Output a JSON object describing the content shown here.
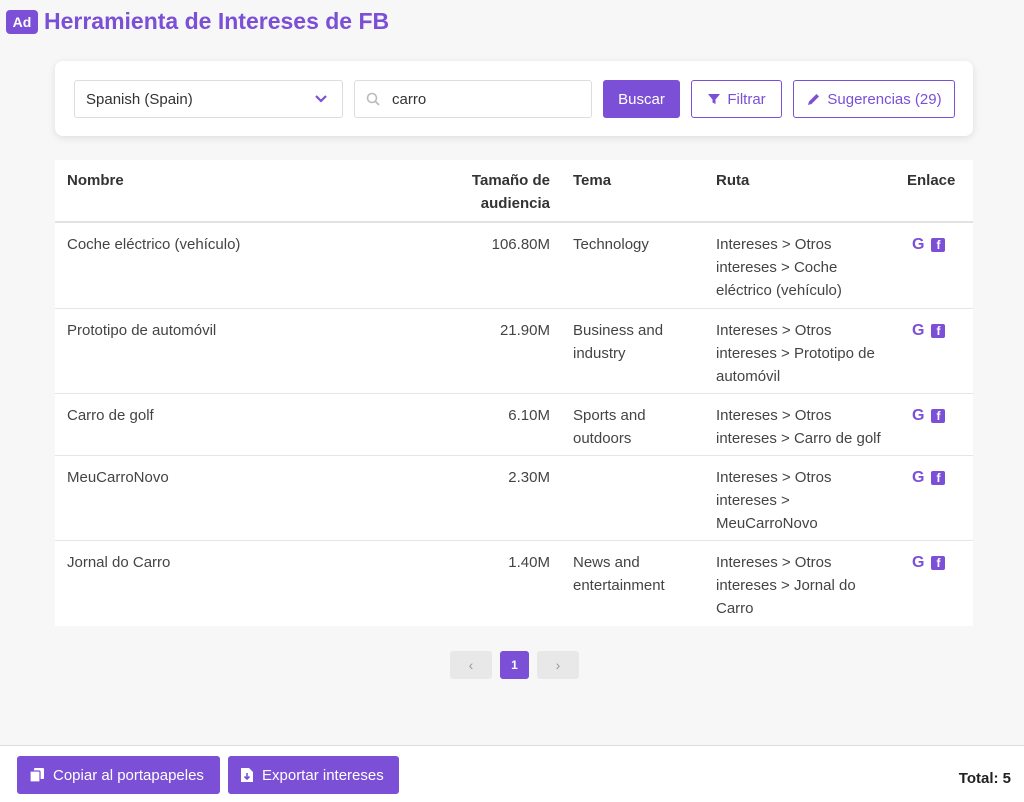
{
  "app": {
    "logo": "Ad",
    "title": "Herramienta de Intereses de FB"
  },
  "search": {
    "language": "Spanish (Spain)",
    "query": "carro",
    "buscar": "Buscar",
    "filtrar": "Filtrar",
    "sugerencias": "Sugerencias (29)"
  },
  "table": {
    "headers": {
      "name": "Nombre",
      "size_line1": "Tamaño de",
      "size_line2": "audiencia",
      "tema": "Tema",
      "ruta": "Ruta",
      "enlace": "Enlace"
    },
    "rows": [
      {
        "name": "Coche eléctrico (vehículo)",
        "size": "106.80M",
        "tema": "Technology",
        "ruta": [
          "Intereses > Otros",
          "intereses > Coche",
          "eléctrico (vehículo)"
        ]
      },
      {
        "name": "Prototipo de automóvil",
        "size": "21.90M",
        "tema": [
          "Business and",
          "industry"
        ],
        "ruta": [
          "Intereses > Otros",
          "intereses > Prototipo de",
          "automóvil"
        ]
      },
      {
        "name": "Carro de golf",
        "size": "6.10M",
        "tema": [
          "Sports and",
          "outdoors"
        ],
        "ruta": [
          "Intereses > Otros",
          "intereses > Carro de golf"
        ]
      },
      {
        "name": "MeuCarroNovo",
        "size": "2.30M",
        "tema": "",
        "ruta": [
          "Intereses > Otros",
          "intereses >",
          "MeuCarroNovo"
        ]
      },
      {
        "name": "Jornal do Carro",
        "size": "1.40M",
        "tema": [
          "News and",
          "entertainment"
        ],
        "ruta": [
          "Intereses > Otros",
          "intereses > Jornal do",
          "Carro"
        ]
      }
    ]
  },
  "pagination": {
    "prev": "‹",
    "current": "1",
    "next": "›"
  },
  "footer": {
    "copy": "Copiar al portapapeles",
    "export": "Exportar intereses",
    "total": "Total: 5"
  },
  "icons": {
    "google": "G",
    "facebook": "f"
  },
  "colors": {
    "accent": "#7b4fd6"
  }
}
